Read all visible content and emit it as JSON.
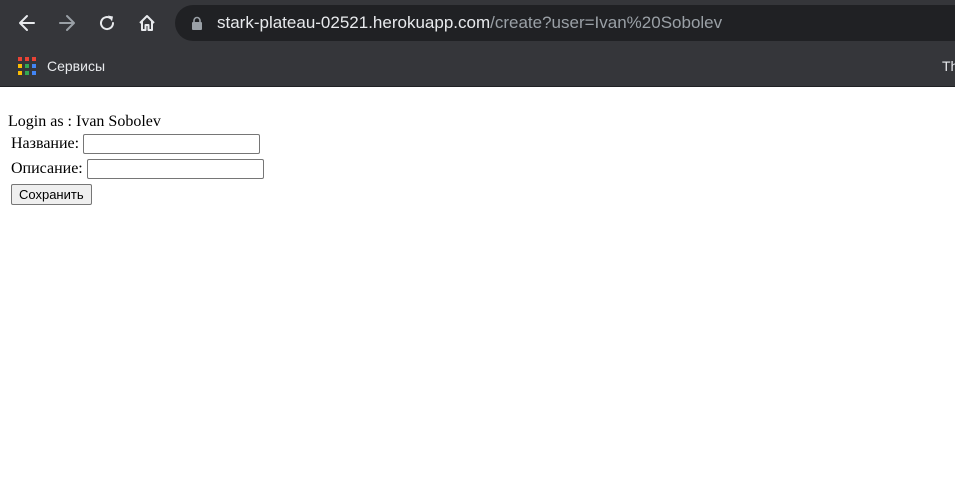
{
  "browser": {
    "url_host": "stark-plateau-02521.herokuapp.com",
    "url_path": "/create?user=Ivan%20Sobolev",
    "bookmarks": {
      "apps_label": "Сервисы",
      "overflow_label": "Th"
    },
    "icons": {
      "back": "arrow-left-icon",
      "forward": "arrow-right-icon",
      "reload": "reload-icon",
      "home": "home-icon",
      "lock": "lock-icon",
      "apps": "apps-grid-icon"
    }
  },
  "page": {
    "login_text": "Login as : Ivan Sobolev",
    "form": {
      "name_label": "Название:",
      "name_value": "",
      "description_label": "Описание:",
      "description_value": "",
      "save_label": "Сохранить"
    }
  }
}
